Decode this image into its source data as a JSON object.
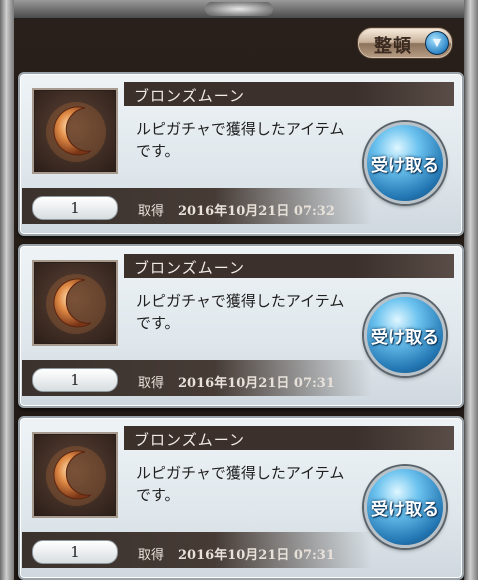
{
  "toolbar": {
    "sort_label": "整頓"
  },
  "icons": {
    "item": "bronze-moon-crescent-icon",
    "sort": "chevron-double-down-icon"
  },
  "colors": {
    "receive_button": "#2478b4",
    "title_bar": "#3c302b",
    "card_bg": "#e6ecef"
  },
  "items": [
    {
      "title": "ブロンズムーン",
      "description": "ルピガチャで獲得したアイテムです。",
      "receive_label": "受け取る",
      "quantity": "1",
      "acquired_label": "取得",
      "acquired_date": "2016年10月21日 07:32"
    },
    {
      "title": "ブロンズムーン",
      "description": "ルピガチャで獲得したアイテムです。",
      "receive_label": "受け取る",
      "quantity": "1",
      "acquired_label": "取得",
      "acquired_date": "2016年10月21日 07:31"
    },
    {
      "title": "ブロンズムーン",
      "description": "ルピガチャで獲得したアイテムです。",
      "receive_label": "受け取る",
      "quantity": "1",
      "acquired_label": "取得",
      "acquired_date": "2016年10月21日 07:31"
    }
  ]
}
